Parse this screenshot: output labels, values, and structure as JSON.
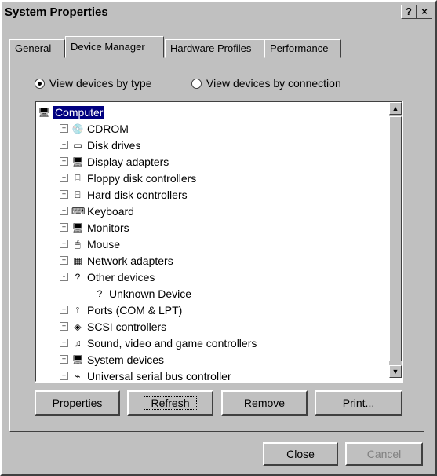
{
  "window": {
    "title": "System Properties",
    "help_label": "?",
    "close_label": "×"
  },
  "tabs": [
    "General",
    "Device Manager",
    "Hardware Profiles",
    "Performance"
  ],
  "view": {
    "by_type_label": "View devices by type",
    "by_connection_label": "View devices by connection",
    "selected": "type"
  },
  "tree": [
    {
      "label": "Computer",
      "level": 0,
      "toggle": "",
      "icon": "computer-icon",
      "glyph": "🖥",
      "selected": true
    },
    {
      "label": "CDROM",
      "level": 1,
      "toggle": "+",
      "icon": "cdrom-icon",
      "glyph": "💿"
    },
    {
      "label": "Disk drives",
      "level": 1,
      "toggle": "+",
      "icon": "disk-drive-icon",
      "glyph": "▭"
    },
    {
      "label": "Display adapters",
      "level": 1,
      "toggle": "+",
      "icon": "monitor-icon",
      "glyph": "🖥"
    },
    {
      "label": "Floppy disk controllers",
      "level": 1,
      "toggle": "+",
      "icon": "floppy-controller-icon",
      "glyph": "⌸"
    },
    {
      "label": "Hard disk controllers",
      "level": 1,
      "toggle": "+",
      "icon": "hard-disk-controller-icon",
      "glyph": "⌸"
    },
    {
      "label": "Keyboard",
      "level": 1,
      "toggle": "+",
      "icon": "keyboard-icon",
      "glyph": "⌨"
    },
    {
      "label": "Monitors",
      "level": 1,
      "toggle": "+",
      "icon": "monitor-icon",
      "glyph": "🖥"
    },
    {
      "label": "Mouse",
      "level": 1,
      "toggle": "+",
      "icon": "mouse-icon",
      "glyph": "🖱"
    },
    {
      "label": "Network adapters",
      "level": 1,
      "toggle": "+",
      "icon": "network-adapter-icon",
      "glyph": "▦"
    },
    {
      "label": "Other devices",
      "level": 1,
      "toggle": "-",
      "icon": "question-icon",
      "glyph": "?"
    },
    {
      "label": "Unknown Device",
      "level": 2,
      "toggle": "",
      "icon": "question-icon",
      "glyph": "?"
    },
    {
      "label": "Ports (COM & LPT)",
      "level": 1,
      "toggle": "+",
      "icon": "port-icon",
      "glyph": "⟟"
    },
    {
      "label": "SCSI controllers",
      "level": 1,
      "toggle": "+",
      "icon": "scsi-icon",
      "glyph": "◈"
    },
    {
      "label": "Sound, video and game controllers",
      "level": 1,
      "toggle": "+",
      "icon": "sound-icon",
      "glyph": "♫"
    },
    {
      "label": "System devices",
      "level": 1,
      "toggle": "+",
      "icon": "system-device-icon",
      "glyph": "🖥"
    },
    {
      "label": "Universal serial bus controller",
      "level": 1,
      "toggle": "+",
      "icon": "usb-icon",
      "glyph": "⌁"
    }
  ],
  "buttons": {
    "properties": "Properties",
    "refresh": "Refresh",
    "remove": "Remove",
    "print": "Print..."
  },
  "footer": {
    "close": "Close",
    "cancel": "Cancel"
  }
}
